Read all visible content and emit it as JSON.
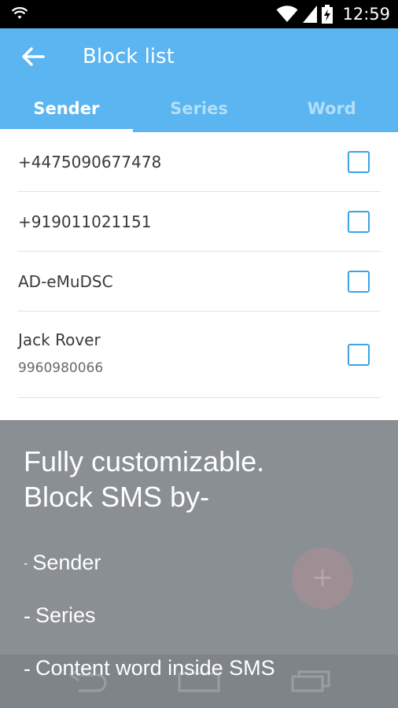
{
  "status_bar": {
    "time": "12:59"
  },
  "app_bar": {
    "title": "Block list"
  },
  "tabs": [
    {
      "label": "Sender",
      "active": true
    },
    {
      "label": "Series",
      "active": false
    },
    {
      "label": "Word",
      "active": false
    }
  ],
  "list": [
    {
      "name": "+4475090677478",
      "checked": false
    },
    {
      "name": "+919011021151",
      "checked": false
    },
    {
      "name": "AD-eMuDSC",
      "checked": false
    },
    {
      "name": "Jack Rover",
      "number": "9960980066",
      "checked": false
    }
  ],
  "promo": {
    "headline_line1": "Fully customizable.",
    "headline_line2": "Block SMS by-",
    "items": [
      "Sender",
      "Series",
      "Content word inside SMS"
    ],
    "bullet": "-"
  },
  "fab": {
    "symbol": "+"
  },
  "icons": {
    "back": "arrow-left-icon",
    "wifi": "wifi-icon",
    "signal": "signal-icon",
    "battery": "battery-icon",
    "nav_back": "nav-back-icon",
    "nav_home": "nav-home-icon",
    "nav_recents": "nav-recents-icon"
  },
  "colors": {
    "primary": "#5ab5f0",
    "checkbox": "#3ba3e6",
    "overlay": "#8a8f94"
  }
}
